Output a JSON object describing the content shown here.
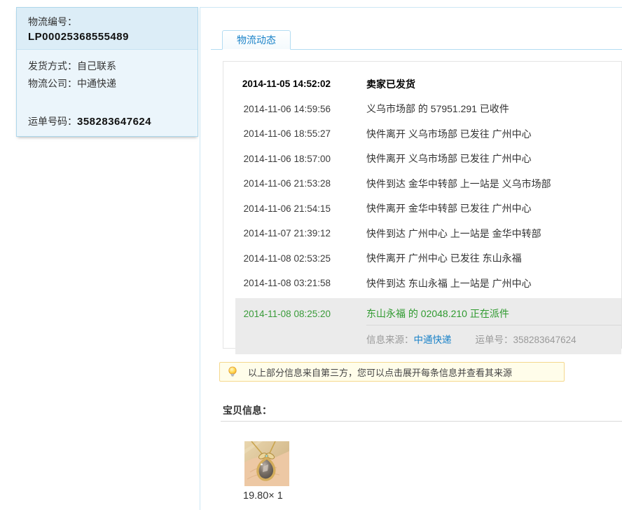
{
  "colors": {
    "accent_blue": "#1a82c8",
    "green_status": "#2f9a2f",
    "panel_blue_dark": "#dcedf7",
    "panel_blue_light": "#ebf5fb",
    "panel_border": "#aed7eb",
    "notice_bg": "#fffdea",
    "notice_border": "#f5d88e",
    "highlight_gray": "#ebebeb"
  },
  "sidebar": {
    "logistics_no_label": "物流编号：",
    "logistics_no": "LP00025368555489",
    "ship_method_label": "发货方式：",
    "ship_method": "自己联系",
    "company_label": "物流公司：",
    "company": "中通快递",
    "waybill_label": "运单号码：",
    "waybill": "358283647624"
  },
  "tab": {
    "label": "物流动态"
  },
  "tracking": {
    "events": [
      {
        "time": "2014-11-05 14:52:02",
        "text": "卖家已发货"
      },
      {
        "time": "2014-11-06 14:59:56",
        "text": "义乌市场部 的 57951.291 已收件"
      },
      {
        "time": "2014-11-06 18:55:27",
        "text": "快件离开 义乌市场部 已发往 广州中心"
      },
      {
        "time": "2014-11-06 18:57:00",
        "text": "快件离开 义乌市场部 已发往 广州中心"
      },
      {
        "time": "2014-11-06 21:53:28",
        "text": "快件到达 金华中转部 上一站是 义乌市场部"
      },
      {
        "time": "2014-11-06 21:54:15",
        "text": "快件离开 金华中转部 已发往 广州中心"
      },
      {
        "time": "2014-11-07 21:39:12",
        "text": "快件到达 广州中心 上一站是 金华中转部"
      },
      {
        "time": "2014-11-08 02:53:25",
        "text": "快件离开 广州中心 已发往 东山永福"
      },
      {
        "time": "2014-11-08 03:21:58",
        "text": "快件到达 东山永福 上一站是 广州中心"
      }
    ],
    "current": {
      "time": "2014-11-08 08:25:20",
      "text": "东山永福 的 02048.210 正在派件",
      "source_label": "信息来源：",
      "source_link": "中通快递",
      "waybill_label": "运单号：",
      "waybill": "358283647624"
    }
  },
  "notice": {
    "icon": "lightbulb-icon",
    "text": "以上部分信息来自第三方，您可以点击展开每条信息并查看其来源"
  },
  "item": {
    "heading": "宝贝信息：",
    "price_qty": "19.80× 1"
  }
}
